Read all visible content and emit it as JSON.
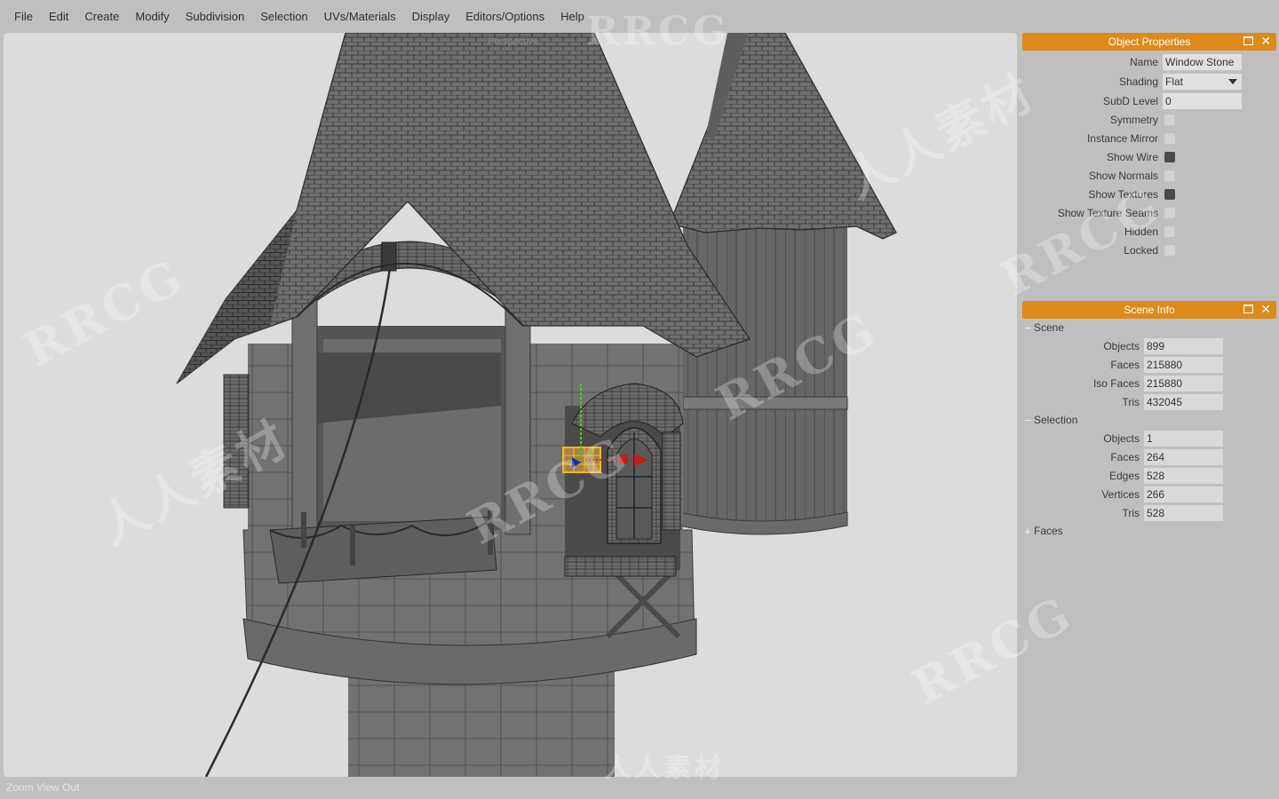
{
  "menu": {
    "items": [
      "File",
      "Edit",
      "Create",
      "Modify",
      "Subdivision",
      "Selection",
      "UVs/Materials",
      "Display",
      "Editors/Options",
      "Help"
    ]
  },
  "viewport": {
    "camera_label": "Perspective",
    "background_color": "#dcdcdc",
    "selection_color": "#f2b531"
  },
  "statusbar": {
    "text": "Zoom View Out"
  },
  "object_properties": {
    "title": "Object Properties",
    "name_label": "Name",
    "name_value": "Window Stone",
    "shading_label": "Shading",
    "shading_value": "Flat",
    "subd_label": "SubD Level",
    "subd_value": "0",
    "toggles": [
      {
        "label": "Symmetry",
        "checked": false
      },
      {
        "label": "Instance Mirror",
        "checked": false
      },
      {
        "label": "Show Wire",
        "checked": true
      },
      {
        "label": "Show Normals",
        "checked": false
      },
      {
        "label": "Show Textures",
        "checked": true
      },
      {
        "label": "Show Texture Seams",
        "checked": false
      },
      {
        "label": "Hidden",
        "checked": false
      },
      {
        "label": "Locked",
        "checked": false
      }
    ]
  },
  "scene_info": {
    "title": "Scene Info",
    "scene_section": {
      "label": "Scene",
      "expanded": true,
      "rows": [
        {
          "label": "Objects",
          "value": "899"
        },
        {
          "label": "Faces",
          "value": "215880"
        },
        {
          "label": "Iso Faces",
          "value": "215880"
        },
        {
          "label": "Tris",
          "value": "432045"
        }
      ]
    },
    "selection_section": {
      "label": "Selection",
      "expanded": true,
      "rows": [
        {
          "label": "Objects",
          "value": "1"
        },
        {
          "label": "Faces",
          "value": "264"
        },
        {
          "label": "Edges",
          "value": "528"
        },
        {
          "label": "Vertices",
          "value": "266"
        },
        {
          "label": "Tris",
          "value": "528"
        }
      ]
    },
    "faces_section": {
      "label": "Faces",
      "expanded": false
    },
    "expanded_sign": "−",
    "collapsed_sign": "+"
  },
  "accent_color": "#dd8a1a",
  "watermarks": [
    "RRCG",
    "人人素材"
  ]
}
